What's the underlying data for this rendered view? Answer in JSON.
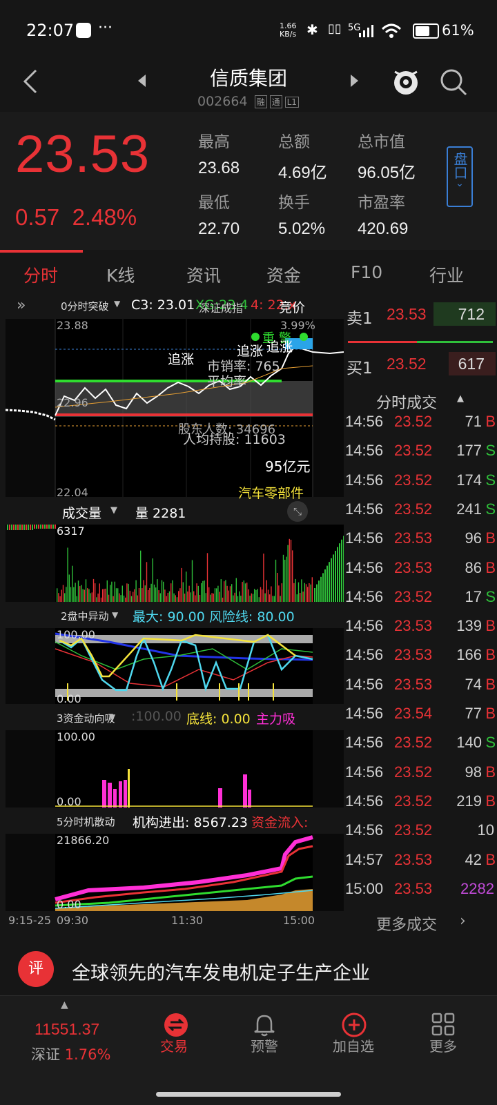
{
  "status_bar": {
    "time": "22:07",
    "net_speed": "1.66 KB/s",
    "signal": "5G",
    "battery": "61%"
  },
  "header": {
    "stock_name": "信质集团",
    "stock_code": "002664",
    "tags": [
      "融",
      "通",
      "L1"
    ]
  },
  "quote": {
    "price": "23.53",
    "change": "0.57",
    "change_pct": "2.48%",
    "stats": [
      {
        "label": "最高",
        "value": "23.68"
      },
      {
        "label": "总额",
        "value": "4.69亿"
      },
      {
        "label": "总市值",
        "value": "96.05亿"
      },
      {
        "label": "最低",
        "value": "22.70"
      },
      {
        "label": "换手",
        "value": "5.02%"
      },
      {
        "label": "市盈率",
        "value": "420.69"
      }
    ],
    "pankou_label": "盘口"
  },
  "tabs": [
    "分时",
    "K线",
    "资讯",
    "资金",
    "F10",
    "行业"
  ],
  "chart": {
    "top_bar": {
      "indicator": "0分时突破",
      "c3": "C3: 23.01",
      "overlay_green": "XG:23.4",
      "overlay_red": "4: 22.x",
      "mid": "深证成指",
      "right": "竞价"
    },
    "price_high_label": "23.88",
    "price_low_label": "22.04",
    "pct_high_label": "3.99%",
    "mid_price_label": "22.96",
    "overlay_texts": [
      "重 警",
      "追涨",
      "追涨",
      "追涨",
      "市销率: 765",
      "平均率",
      "股东人数: 34696",
      "人均持股: 11603",
      "95亿元",
      "汽车零部件"
    ],
    "volume_bar": {
      "label": "成交量",
      "value": "量 2281",
      "max": "6317"
    },
    "ind2": {
      "label": "2盘中异动",
      "text": "最大: 90.00 风险线: 80.00",
      "top": "100.00",
      "bottom": "0.00"
    },
    "ind3": {
      "label": "3资金动向吸",
      "prefix": ":100.00",
      "text": "底线: 0.00",
      "extra": "主力吸",
      "top": "100.00",
      "bottom": "0.00"
    },
    "ind5": {
      "label": "5分时机散动",
      "text": "机构进出: 8567.23",
      "extra": "资金流入:",
      "top": "21866.20",
      "bottom": "0.00"
    },
    "x_axis": [
      "9:15-25",
      "09:30",
      "11:30",
      "15:00"
    ]
  },
  "orderbook": {
    "sell": {
      "label": "卖1",
      "price": "23.53",
      "vol": "712"
    },
    "buy": {
      "label": "买1",
      "price": "23.52",
      "vol": "617"
    }
  },
  "trades_header": "分时成交",
  "trades": [
    {
      "time": "14:56",
      "price": "23.52",
      "vol": "71",
      "side": "B"
    },
    {
      "time": "14:56",
      "price": "23.52",
      "vol": "177",
      "side": "S"
    },
    {
      "time": "14:56",
      "price": "23.52",
      "vol": "174",
      "side": "S"
    },
    {
      "time": "14:56",
      "price": "23.52",
      "vol": "241",
      "side": "S"
    },
    {
      "time": "14:56",
      "price": "23.53",
      "vol": "96",
      "side": "B"
    },
    {
      "time": "14:56",
      "price": "23.53",
      "vol": "86",
      "side": "B"
    },
    {
      "time": "14:56",
      "price": "23.52",
      "vol": "17",
      "side": "S"
    },
    {
      "time": "14:56",
      "price": "23.53",
      "vol": "139",
      "side": "B"
    },
    {
      "time": "14:56",
      "price": "23.53",
      "vol": "166",
      "side": "B"
    },
    {
      "time": "14:56",
      "price": "23.53",
      "vol": "74",
      "side": "B"
    },
    {
      "time": "14:56",
      "price": "23.54",
      "vol": "77",
      "side": "B"
    },
    {
      "time": "14:56",
      "price": "23.52",
      "vol": "140",
      "side": "S"
    },
    {
      "time": "14:56",
      "price": "23.52",
      "vol": "98",
      "side": "B"
    },
    {
      "time": "14:56",
      "price": "23.52",
      "vol": "219",
      "side": "B"
    },
    {
      "time": "14:56",
      "price": "23.52",
      "vol": "10",
      "side": ""
    },
    {
      "time": "14:57",
      "price": "23.53",
      "vol": "42",
      "side": "B"
    },
    {
      "time": "15:00",
      "price": "23.53",
      "vol": "2282",
      "side": ""
    }
  ],
  "more_trades": "更多成交",
  "news": {
    "badge": "评",
    "text": "全球领先的汽车发电机定子生产企业"
  },
  "bottom_nav": {
    "index_value": "11551.37",
    "index_name": "深证",
    "index_pct": "1.76%",
    "items": [
      "交易",
      "预警",
      "加自选",
      "更多"
    ]
  },
  "colors": {
    "up": "#e83236",
    "down": "#2fbf3a",
    "accent_blue": "#3a7fd6",
    "yellow": "#f5e33b",
    "cyan": "#4fd8ef",
    "magenta": "#ff2fd6"
  }
}
